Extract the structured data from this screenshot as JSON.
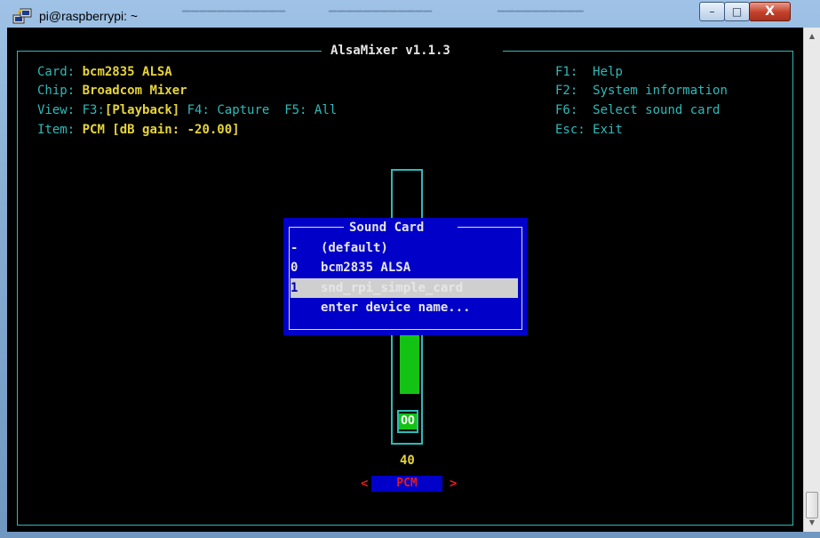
{
  "window": {
    "title": "pi@raspberrypi: ~",
    "buttons": {
      "minimize": "–",
      "maximize": "□",
      "close": "X"
    }
  },
  "mixer": {
    "title": "AlsaMixer v1.1.3",
    "card_label": "Card:",
    "card_value": "bcm2835 ALSA",
    "chip_label": "Chip:",
    "chip_value": "Broadcom Mixer",
    "view_label": "View:",
    "view_f3": "F3:",
    "view_playback": "[Playback]",
    "view_f4": "F4: Capture",
    "view_f5": "F5: All",
    "item_label": "Item:",
    "item_value": "PCM [dB gain: -20.00]",
    "help": [
      {
        "key": "F1:",
        "text": "Help"
      },
      {
        "key": "F2:",
        "text": "System information"
      },
      {
        "key": "F6:",
        "text": "Select sound card"
      },
      {
        "key": "Esc:",
        "text": "Exit"
      }
    ],
    "volume_value": "40",
    "volume_level_percent": 40,
    "mute_indicator": "OO",
    "control_name": "PCM",
    "left_arrow": "<",
    "right_arrow": ">"
  },
  "sound_card_dialog": {
    "title": "Sound Card",
    "items": [
      {
        "key": "-",
        "label": "(default)"
      },
      {
        "key": "0",
        "label": "bcm2835 ALSA"
      },
      {
        "key": "1",
        "label": "snd_rpi_simple_card"
      },
      {
        "key": "",
        "label": "enter device name..."
      }
    ],
    "selected_index": 2
  },
  "colors": {
    "terminal_bg": "#000000",
    "cyan": "#2fb9b9",
    "yellow": "#e6d43a",
    "dialog_bg": "#0000c8",
    "volume_green": "#13c313",
    "pcm_red": "#e31c1c"
  }
}
